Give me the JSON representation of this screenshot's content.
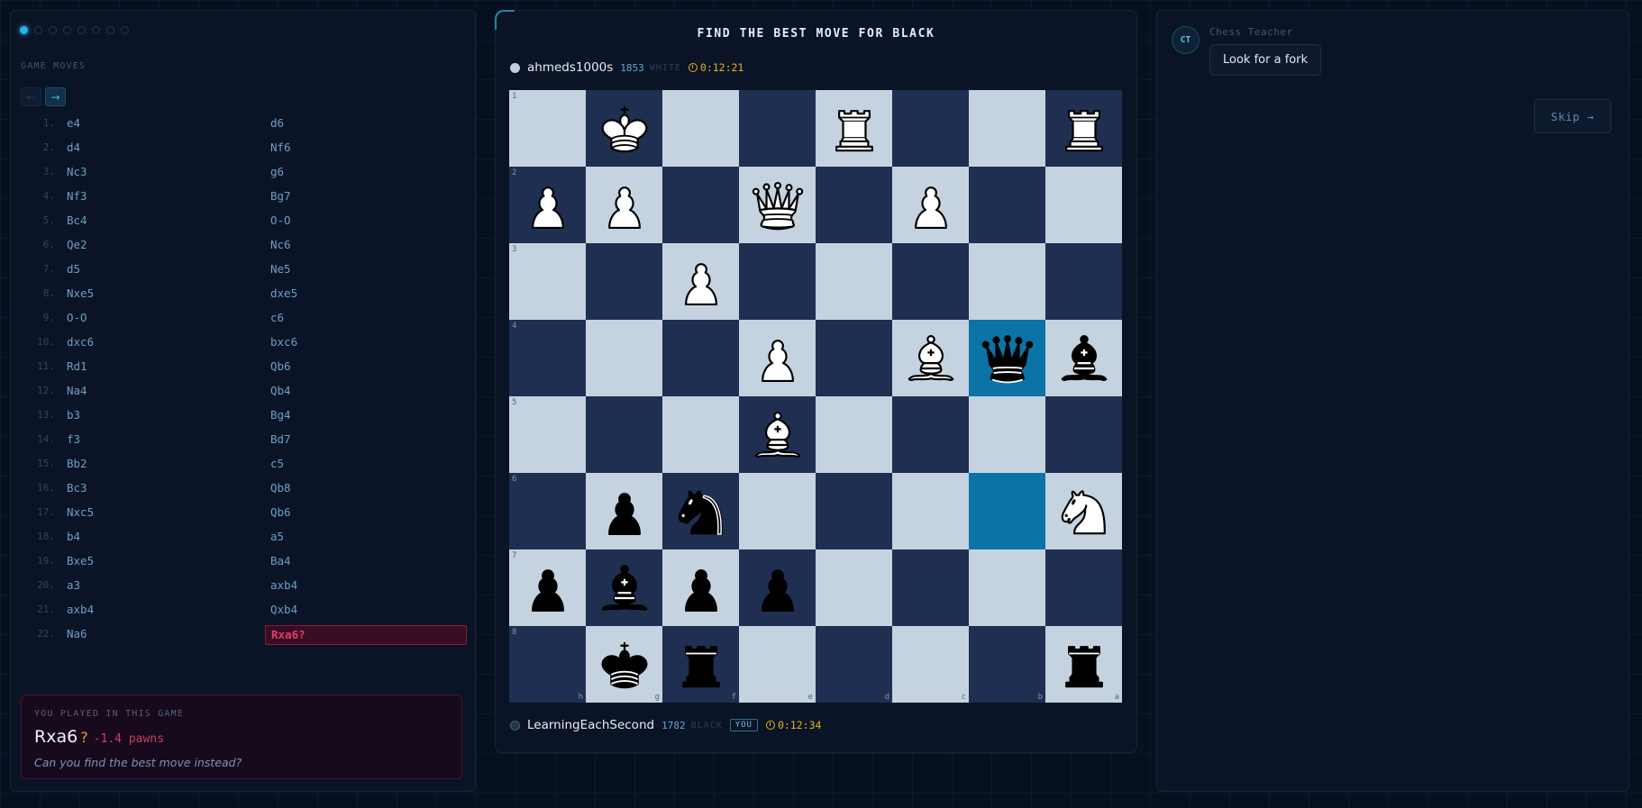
{
  "move_nav": {
    "dots": [
      true,
      false,
      false,
      false,
      false,
      false,
      false,
      false
    ],
    "heading": "GAME MOVES",
    "prev_icon": "←",
    "next_icon": "→"
  },
  "moves": [
    {
      "num": "1.",
      "white": "e4",
      "black": "d6"
    },
    {
      "num": "2.",
      "white": "d4",
      "black": "Nf6"
    },
    {
      "num": "3.",
      "white": "Nc3",
      "black": "g6"
    },
    {
      "num": "4.",
      "white": "Nf3",
      "black": "Bg7"
    },
    {
      "num": "5.",
      "white": "Bc4",
      "black": "O-O"
    },
    {
      "num": "6.",
      "white": "Qe2",
      "black": "Nc6"
    },
    {
      "num": "7.",
      "white": "d5",
      "black": "Ne5"
    },
    {
      "num": "8.",
      "white": "Nxe5",
      "black": "dxe5"
    },
    {
      "num": "9.",
      "white": "O-O",
      "black": "c6"
    },
    {
      "num": "10.",
      "white": "dxc6",
      "black": "bxc6"
    },
    {
      "num": "11.",
      "white": "Rd1",
      "black": "Qb6"
    },
    {
      "num": "12.",
      "white": "Na4",
      "black": "Qb4"
    },
    {
      "num": "13.",
      "white": "b3",
      "black": "Bg4"
    },
    {
      "num": "14.",
      "white": "f3",
      "black": "Bd7"
    },
    {
      "num": "15.",
      "white": "Bb2",
      "black": "c5"
    },
    {
      "num": "16.",
      "white": "Bc3",
      "black": "Qb8"
    },
    {
      "num": "17.",
      "white": "Nxc5",
      "black": "Qb6"
    },
    {
      "num": "18.",
      "white": "b4",
      "black": "a5"
    },
    {
      "num": "19.",
      "white": "Bxe5",
      "black": "Ba4"
    },
    {
      "num": "20.",
      "white": "a3",
      "black": "axb4"
    },
    {
      "num": "21.",
      "white": "axb4",
      "black": "Qxb4"
    },
    {
      "num": "22.",
      "white": "Na6",
      "black": "Rxa6?"
    }
  ],
  "highlighted_move_index": 21,
  "played": {
    "label": "YOU PLAYED IN THIS GAME",
    "move": "Rxa6",
    "mark": "?",
    "eval": "-1.4 pawns",
    "question": "Can you find the best move instead?"
  },
  "puzzle": {
    "title": "FIND THE BEST MOVE FOR BLACK"
  },
  "top_player": {
    "name": "ahmeds1000s",
    "rating": "1853",
    "color": "WHITE",
    "clock": "0:12:21"
  },
  "bottom_player": {
    "name": "LearningEachSecond",
    "rating": "1782",
    "color": "BLACK",
    "badge": "YOU",
    "clock": "0:12:34"
  },
  "board": {
    "orientation": "black",
    "rank_labels": [
      "1",
      "2",
      "3",
      "4",
      "5",
      "6",
      "7",
      "8"
    ],
    "file_labels": [
      "h",
      "g",
      "f",
      "e",
      "d",
      "c",
      "b",
      "a"
    ],
    "rows": [
      [
        "",
        "wK",
        "",
        "",
        "wR",
        "",
        "",
        "wR"
      ],
      [
        "wP",
        "wP",
        "",
        "wQ",
        "",
        "wP",
        "",
        ""
      ],
      [
        "",
        "",
        "wP",
        "",
        "",
        "",
        "",
        ""
      ],
      [
        "",
        "",
        "",
        "wP",
        "",
        "wB",
        "bQ",
        "bB"
      ],
      [
        "",
        "",
        "",
        "wB",
        "",
        "",
        "",
        ""
      ],
      [
        "",
        "bP",
        "bN",
        "",
        "",
        "",
        "",
        "wN"
      ],
      [
        "bP",
        "bB",
        "bP",
        "bP",
        "",
        "",
        "",
        ""
      ],
      [
        "",
        "bK",
        "bR",
        "",
        "",
        "",
        "",
        "bR"
      ]
    ],
    "highlighted": [
      [
        3,
        6
      ],
      [
        5,
        6
      ]
    ],
    "colors": {
      "light": "#c5d3e1",
      "dark": "#1e2f51",
      "highlight": "#0b73a6"
    }
  },
  "teacher": {
    "avatar": "CT",
    "name": "Chess Teacher",
    "message": "Look for a fork",
    "skip_label": "Skip →"
  }
}
